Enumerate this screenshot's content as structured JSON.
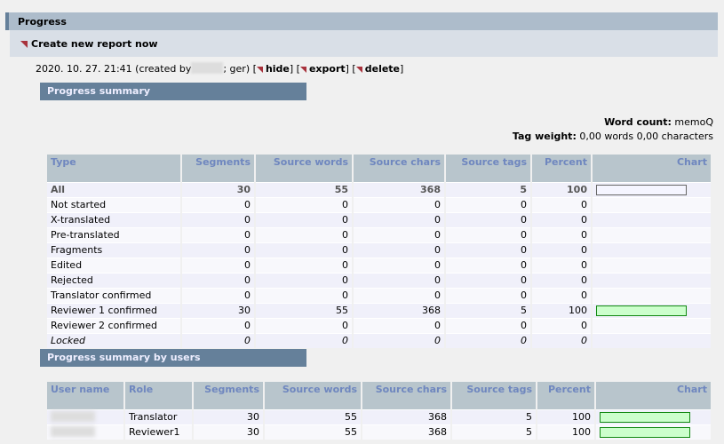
{
  "header": {
    "title": "Progress",
    "create_label": "Create new report now"
  },
  "report": {
    "date": "2020. 10. 27. 21:41",
    "created_by_prefix": "(created by",
    "created_by_suffix": "; ger)",
    "hide": "hide",
    "export": "export",
    "delete": "delete"
  },
  "summary": {
    "title": "Progress summary",
    "word_count_label": "Word count:",
    "word_count_value": "memoQ",
    "tag_weight_label": "Tag weight:",
    "tag_weight_value": "0,00 words 0,00 characters",
    "columns": [
      "Type",
      "Segments",
      "Source words",
      "Source chars",
      "Source tags",
      "Percent",
      "Chart"
    ],
    "rows": [
      {
        "type": "All",
        "segments": "30",
        "words": "55",
        "chars": "368",
        "tags": "5",
        "percent": "100",
        "bar": 100
      },
      {
        "type": "Not started",
        "segments": "0",
        "words": "0",
        "chars": "0",
        "tags": "0",
        "percent": "0"
      },
      {
        "type": "X-translated",
        "segments": "0",
        "words": "0",
        "chars": "0",
        "tags": "0",
        "percent": "0"
      },
      {
        "type": "Pre-translated",
        "segments": "0",
        "words": "0",
        "chars": "0",
        "tags": "0",
        "percent": "0"
      },
      {
        "type": "Fragments",
        "segments": "0",
        "words": "0",
        "chars": "0",
        "tags": "0",
        "percent": "0"
      },
      {
        "type": "Edited",
        "segments": "0",
        "words": "0",
        "chars": "0",
        "tags": "0",
        "percent": "0"
      },
      {
        "type": "Rejected",
        "segments": "0",
        "words": "0",
        "chars": "0",
        "tags": "0",
        "percent": "0"
      },
      {
        "type": "Translator confirmed",
        "segments": "0",
        "words": "0",
        "chars": "0",
        "tags": "0",
        "percent": "0"
      },
      {
        "type": "Reviewer 1 confirmed",
        "segments": "30",
        "words": "55",
        "chars": "368",
        "tags": "5",
        "percent": "100",
        "bar": 100
      },
      {
        "type": "Reviewer 2 confirmed",
        "segments": "0",
        "words": "0",
        "chars": "0",
        "tags": "0",
        "percent": "0"
      },
      {
        "type": "Locked",
        "segments": "0",
        "words": "0",
        "chars": "0",
        "tags": "0",
        "percent": "0"
      }
    ]
  },
  "users": {
    "title": "Progress summary by users",
    "columns": [
      "User name",
      "Role",
      "Segments",
      "Source words",
      "Source chars",
      "Source tags",
      "Percent",
      "Chart"
    ],
    "rows": [
      {
        "role": "Translator",
        "segments": "30",
        "words": "55",
        "chars": "368",
        "tags": "5",
        "percent": "100",
        "bar": 100
      },
      {
        "role": "Reviewer1",
        "segments": "30",
        "words": "55",
        "chars": "368",
        "tags": "5",
        "percent": "100",
        "bar": 100
      }
    ]
  },
  "colors": {
    "header_bg": "#adbccb",
    "section_bg": "#65809a",
    "column_header_text": "#6f87bf",
    "bar_fill": "#ccffcc",
    "bar_border": "#118811"
  }
}
